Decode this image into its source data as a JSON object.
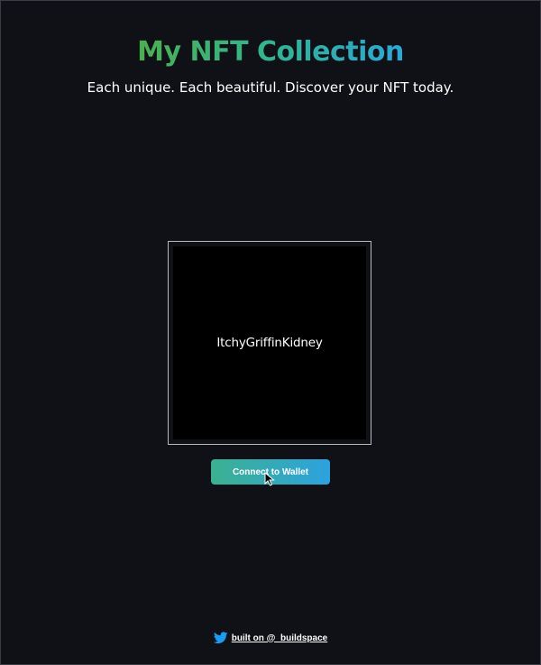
{
  "header": {
    "title": "My NFT Collection",
    "subtitle": "Each unique. Each beautiful. Discover your NFT today."
  },
  "nft": {
    "name": "ItchyGriffinKidney"
  },
  "actions": {
    "connect_label": "Connect to Wallet"
  },
  "footer": {
    "link_text": "built on @_buildspace",
    "icon": "twitter-icon"
  },
  "colors": {
    "background": "#0f1116",
    "gradient_start": "#4caf50",
    "gradient_end": "#2ea6d8",
    "button_start": "#3cb190",
    "button_end": "#2da2df",
    "twitter_blue": "#1d9bf0"
  }
}
